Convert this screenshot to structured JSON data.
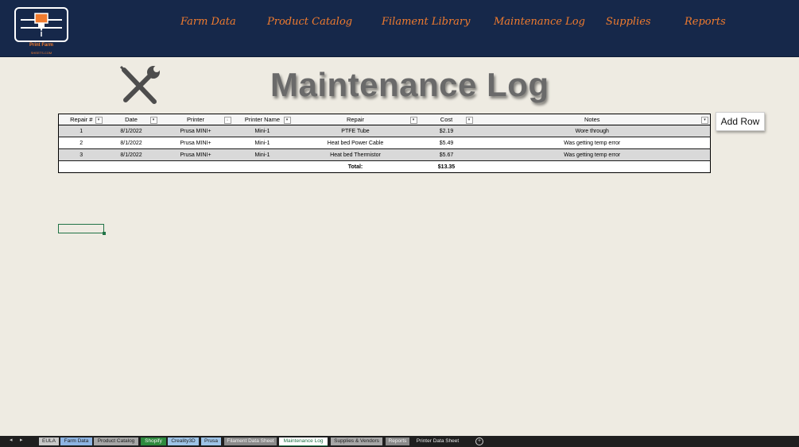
{
  "logo": {
    "name": "Print Farm",
    "sub": "SHEETS.COM"
  },
  "nav": [
    "Farm Data",
    "Product Catalog",
    "Filament Library",
    "Maintenance Log",
    "Supplies",
    "Reports"
  ],
  "title": "Maintenance Log",
  "table": {
    "headers": [
      "Repair #",
      "Date",
      "Printer",
      "Printer Name",
      "Repair",
      "Cost",
      "Notes"
    ],
    "rows": [
      [
        "1",
        "8/1/2022",
        "Prusa MINI+",
        "Mini-1",
        "PTFE Tube",
        "$2.19",
        "Wore through"
      ],
      [
        "2",
        "8/1/2022",
        "Prusa MINI+",
        "Mini-1",
        "Heat bed Power Cable",
        "$5.49",
        "Was getting temp error"
      ],
      [
        "3",
        "8/1/2022",
        "Prusa MINI+",
        "Mini-1",
        "Heat bed Thermistor",
        "$5.67",
        "Was getting temp error"
      ]
    ],
    "total_label": "Total:",
    "total_value": "$13.35"
  },
  "add_row_label": "Add Row",
  "sheet_tabs": [
    {
      "label": "EULA",
      "color": "#c8c8c8"
    },
    {
      "label": "Farm Data",
      "color": "#8db4e2"
    },
    {
      "label": "Product Catalog",
      "color": "#a6a6a6"
    },
    {
      "label": "Shopify",
      "color": "#2e8b3e"
    },
    {
      "label": "Creality3D",
      "color": "#9dc3e6"
    },
    {
      "label": "Prusa",
      "color": "#9dc3e6"
    },
    {
      "label": "Filament Data Sheet",
      "color": "#8a8a8a"
    },
    {
      "label": "Maintenance Log",
      "color": "#ffffff",
      "active": true
    },
    {
      "label": "Supplies & Vendors",
      "color": "#a6a6a6"
    },
    {
      "label": "Reports",
      "color": "#8a8a8a"
    },
    {
      "label": "Printer Data Sheet",
      "color": "#1f1f1f"
    }
  ],
  "colors": {
    "header_bg": "#16284a",
    "accent": "#f07b2e",
    "page_bg": "#eeebe2",
    "active_tab_text": "#217346"
  }
}
